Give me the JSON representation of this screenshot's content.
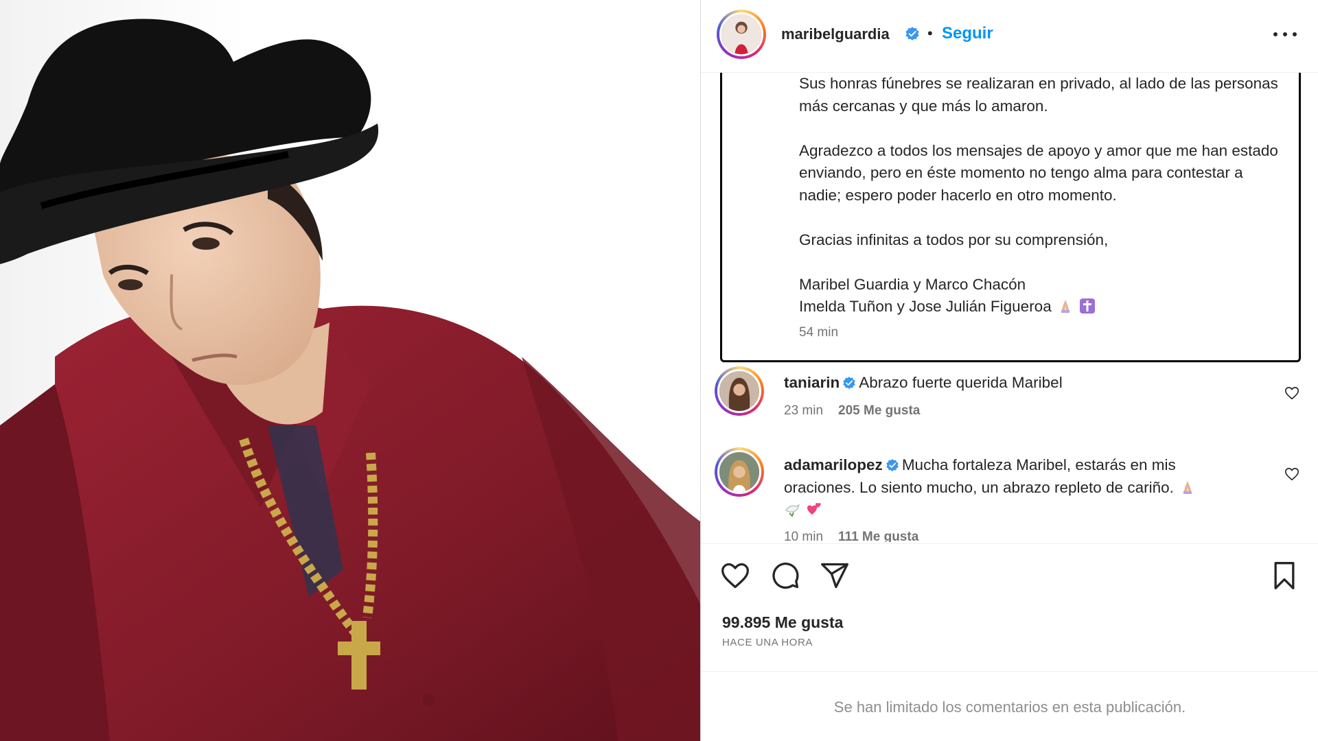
{
  "post": {
    "username": "maribelguardia",
    "follow_label": "Seguir",
    "separator": "•"
  },
  "caption": {
    "paragraphs": [
      "Sus honras fúnebres se realizaran en privado, al lado de las personas más cercanas y que más lo amaron.",
      "Agradezco a todos los mensajes de apoyo y amor que me han estado enviando, pero en éste momento no tengo alma para contestar a nadie; espero poder hacerlo en otro momento.",
      "Gracias infinitas a todos por su comprensión,"
    ],
    "signature_line1": "Maribel Guardia y Marco Chacón",
    "signature_line2": "Imelda Tuñon y Jose Julián Figueroa",
    "emojis": [
      "folded-hands-icon",
      "latin-cross-icon"
    ],
    "time": "54 min"
  },
  "comments": [
    {
      "username": "taniarin",
      "text": "Abrazo fuerte querida Maribel",
      "time": "23 min",
      "likes": "205 Me gusta"
    },
    {
      "username": "adamarilopez",
      "text": "Mucha fortaleza Maribel, estarás en mis oraciones. Lo siento mucho, un abrazo repleto de cariño.",
      "emojis": [
        "folded-hands-icon",
        "dove-icon",
        "two-hearts-icon"
      ],
      "time": "10 min",
      "likes": "111 Me gusta"
    }
  ],
  "stats": {
    "likes": "99.895 Me gusta",
    "posted": "HACE UNA HORA"
  },
  "footer": {
    "notice": "Se han limitado los comentarios en esta publicación."
  },
  "colors": {
    "accent": "#0095f6",
    "verified": "#3897f0",
    "text": "#262626",
    "muted": "#737373",
    "shirt": "#8b1c2c"
  }
}
